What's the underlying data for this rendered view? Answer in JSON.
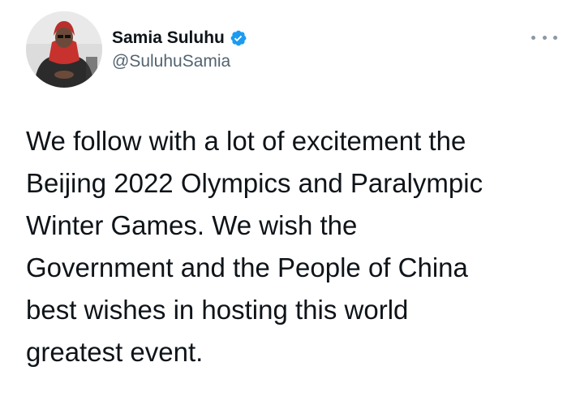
{
  "author": {
    "display_name": "Samia Suluhu",
    "handle": "@SuluhuSamia",
    "verified": true
  },
  "icons": {
    "verified": "verified-badge-icon",
    "more": "more-options-icon"
  },
  "colors": {
    "verified_blue": "#1d9bf0",
    "text": "#0f1419",
    "secondary_text": "#536471"
  },
  "tweet": {
    "lines": [
      "We follow with a lot of excitement the",
      "Beijing 2022 Olympics and Paralympic",
      "Winter Games. We wish the",
      "Government and the People of China",
      "best wishes in hosting this world",
      "greatest event."
    ]
  }
}
